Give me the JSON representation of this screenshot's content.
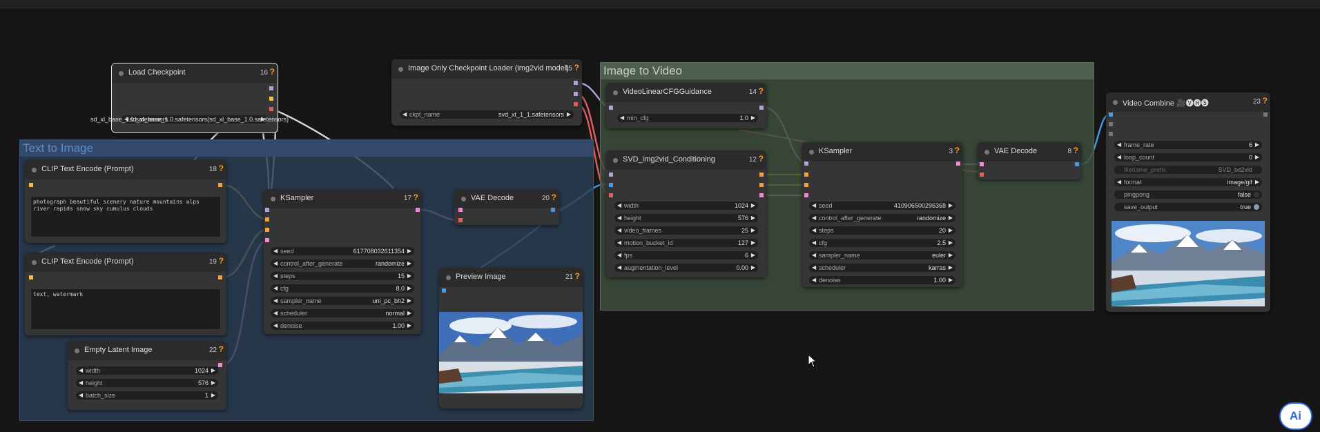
{
  "colors": {
    "group_blue": "#2b3e56",
    "group_green": "#3f5140",
    "link_model": "#b1a2d8",
    "link_clip": "#f0c040",
    "link_vae": "#e06060",
    "link_cond": "#f0a040",
    "link_latent": "#f08ad8",
    "link_image": "#4a9ae0",
    "warn": "#f0a030"
  },
  "groups": {
    "t2i": "Text to Image",
    "i2v": "Image to Video"
  },
  "loose_widget": "sd_xl_base_1.0.safetensors",
  "load_ckpt": {
    "title": "Load Checkpoint",
    "id": "16",
    "ckpt": "sd_xl_base_1.0.safetensors(sd_xl_base_1.0.safetensors)"
  },
  "img_ckpt": {
    "title": "Image Only Checkpoint Loader (img2vid model)",
    "id": "15",
    "label": "ckpt_name",
    "value": "svd_xt_1_1.safetensors"
  },
  "clip18": {
    "title": "CLIP Text Encode (Prompt)",
    "id": "18",
    "text": "photograph beautiful scenery nature mountains alps river rapids snow sky cumulus clouds"
  },
  "clip19": {
    "title": "CLIP Text Encode (Prompt)",
    "id": "19",
    "text": "text, watermark"
  },
  "latent22": {
    "title": "Empty Latent Image",
    "id": "22",
    "widgets": [
      {
        "label": "width",
        "value": "1024"
      },
      {
        "label": "height",
        "value": "576"
      },
      {
        "label": "batch_size",
        "value": "1"
      }
    ]
  },
  "ks17": {
    "title": "KSampler",
    "id": "17",
    "widgets": [
      {
        "label": "seed",
        "value": "617708032611354"
      },
      {
        "label": "control_after_generate",
        "value": "randomize"
      },
      {
        "label": "steps",
        "value": "15"
      },
      {
        "label": "cfg",
        "value": "8.0"
      },
      {
        "label": "sampler_name",
        "value": "uni_pc_bh2"
      },
      {
        "label": "scheduler",
        "value": "normal"
      },
      {
        "label": "denoise",
        "value": "1.00"
      }
    ]
  },
  "vae20": {
    "title": "VAE Decode",
    "id": "20"
  },
  "prev21": {
    "title": "Preview Image",
    "id": "21"
  },
  "vlcfg14": {
    "title": "VideoLinearCFGGuidance",
    "id": "14",
    "widgets": [
      {
        "label": "min_cfg",
        "value": "1.0"
      }
    ]
  },
  "svd12": {
    "title": "SVD_img2vid_Conditioning",
    "id": "12",
    "widgets": [
      {
        "label": "width",
        "value": "1024"
      },
      {
        "label": "height",
        "value": "576"
      },
      {
        "label": "video_frames",
        "value": "25"
      },
      {
        "label": "motion_bucket_id",
        "value": "127"
      },
      {
        "label": "fps",
        "value": "6"
      },
      {
        "label": "augmentation_level",
        "value": "0.00"
      }
    ]
  },
  "ks3": {
    "title": "KSampler",
    "id": "3",
    "widgets": [
      {
        "label": "seed",
        "value": "410906500296368"
      },
      {
        "label": "control_after_generate",
        "value": "randomize"
      },
      {
        "label": "steps",
        "value": "20"
      },
      {
        "label": "cfg",
        "value": "2.5"
      },
      {
        "label": "sampler_name",
        "value": "euler"
      },
      {
        "label": "scheduler",
        "value": "karras"
      },
      {
        "label": "denoise",
        "value": "1.00"
      }
    ]
  },
  "vae8": {
    "title": "VAE Decode",
    "id": "8"
  },
  "vc23": {
    "title": "Video Combine 🎥🅥🅗🅢",
    "id": "23",
    "widgets": [
      {
        "label": "frame_rate",
        "value": "6"
      },
      {
        "label": "loop_count",
        "value": "0"
      },
      {
        "label": "filename_prefix",
        "value": "SVD_txt2vid"
      },
      {
        "label": "format",
        "value": "image/gif"
      },
      {
        "label": "pingpong",
        "value": "false"
      },
      {
        "label": "save_output",
        "value": "true"
      }
    ]
  },
  "badge": "Ai",
  "warn_icon": "?"
}
